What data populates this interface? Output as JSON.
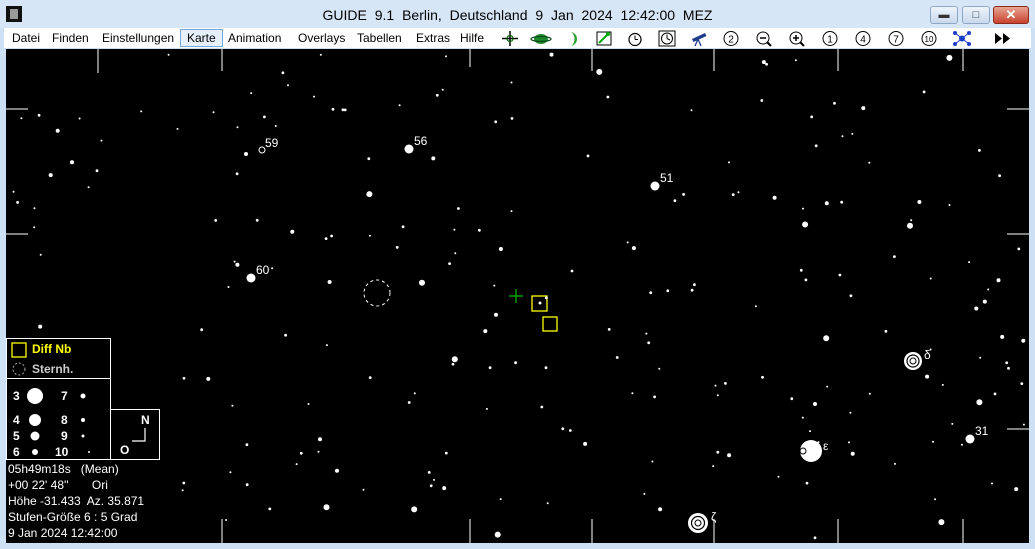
{
  "window": {
    "title": "GUIDE 9.1   Berlin, Deutschland     9 Jan 2024 12:42:00 MEZ",
    "minimize_glyph": "▬",
    "maximize_glyph": "□",
    "close_glyph": "✕"
  },
  "menu": [
    {
      "label": "Datei"
    },
    {
      "label": "Finden"
    },
    {
      "label": "Einstellungen"
    },
    {
      "label": "Karte",
      "active": true
    },
    {
      "label": "Animation"
    },
    {
      "label": "Overlays"
    },
    {
      "label": "Tabellen"
    },
    {
      "label": "Extras"
    },
    {
      "label": "Hilfe"
    }
  ],
  "toolbar": {
    "icons": [
      "crosshair-icon",
      "planet-icon",
      "moon-phase-icon",
      "comet-icon",
      "alarm-clock-icon",
      "clock-icon",
      "telescope-icon",
      "zoom-level-2-icon",
      "zoom-out-icon",
      "zoom-in-icon",
      "zoom-level-1-icon",
      "zoom-level-4-icon",
      "zoom-level-7-icon",
      "zoom-level-10-icon",
      "network-icon",
      "fast-forward-icon"
    ],
    "zoom_labels": {
      "z2": "2",
      "z1": "1",
      "z4": "4",
      "z7": "7",
      "z10": "10"
    }
  },
  "map": {
    "star_labels": [
      {
        "text": "59"
      },
      {
        "text": "56"
      },
      {
        "text": "51"
      },
      {
        "text": "60"
      },
      {
        "text": "δ"
      },
      {
        "text": "31"
      },
      {
        "text": "ε"
      },
      {
        "text": "ζ"
      }
    ],
    "legend": {
      "diff_nb": "Diff Nb",
      "sternh": "Sternh.",
      "mag_left": [
        "3",
        "4",
        "5",
        "6"
      ],
      "mag_right": [
        "7",
        "8",
        "9",
        "10"
      ]
    },
    "compass": {
      "north": "N",
      "east": "O"
    },
    "info": {
      "ra": "05h49m18s   (Mean)",
      "dec": "+00 22' 48''       Ori",
      "altaz": "Höhe -31.433  Az. 35.871",
      "scale": "Stufen-Größe 6 : 5 Grad",
      "datetime": "9 Jan 2024 12:42:00"
    },
    "colors": {
      "background": "#000000",
      "stars": "#ffffff",
      "highlight": "#ffff00",
      "cursor": "#00c000"
    }
  }
}
